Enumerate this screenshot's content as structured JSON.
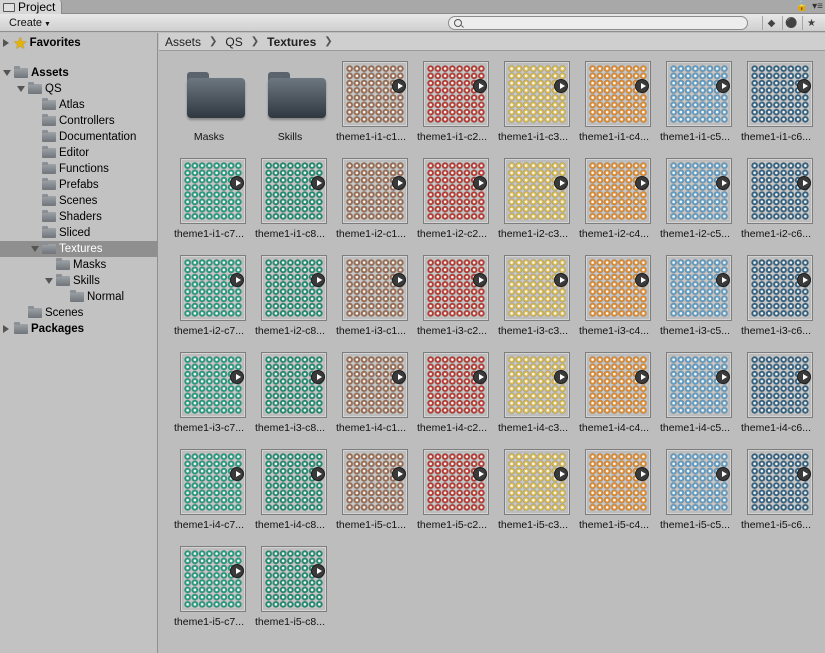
{
  "window": {
    "tab_title": "Project",
    "lock_icon": "lock-icon",
    "menu_icon": "window-menu-icon"
  },
  "toolbar": {
    "create_label": "Create",
    "search_placeholder": "",
    "icons": [
      "filter-by-type-icon",
      "filter-by-label-icon",
      "favorite-star-icon"
    ]
  },
  "sidebar": {
    "items": [
      {
        "label": "Favorites",
        "depth": 0,
        "arrow": "right",
        "icon": "star",
        "bold": true
      },
      {
        "label": "Assets",
        "depth": 0,
        "arrow": "down",
        "icon": "folder",
        "bold": true
      },
      {
        "label": "QS",
        "depth": 1,
        "arrow": "down",
        "icon": "folder"
      },
      {
        "label": "Atlas",
        "depth": 2,
        "arrow": "none",
        "icon": "folder"
      },
      {
        "label": "Controllers",
        "depth": 2,
        "arrow": "none",
        "icon": "folder"
      },
      {
        "label": "Documentation",
        "depth": 2,
        "arrow": "none",
        "icon": "folder"
      },
      {
        "label": "Editor",
        "depth": 2,
        "arrow": "none",
        "icon": "folder"
      },
      {
        "label": "Functions",
        "depth": 2,
        "arrow": "none",
        "icon": "folder"
      },
      {
        "label": "Prefabs",
        "depth": 2,
        "arrow": "none",
        "icon": "folder"
      },
      {
        "label": "Scenes",
        "depth": 2,
        "arrow": "none",
        "icon": "folder"
      },
      {
        "label": "Shaders",
        "depth": 2,
        "arrow": "none",
        "icon": "folder"
      },
      {
        "label": "Sliced",
        "depth": 2,
        "arrow": "none",
        "icon": "folder"
      },
      {
        "label": "Textures",
        "depth": 2,
        "arrow": "down",
        "icon": "folder",
        "selected": true
      },
      {
        "label": "Masks",
        "depth": 3,
        "arrow": "none",
        "icon": "folder"
      },
      {
        "label": "Skills",
        "depth": 3,
        "arrow": "down",
        "icon": "folder"
      },
      {
        "label": "Normal",
        "depth": 4,
        "arrow": "none",
        "icon": "folder"
      },
      {
        "label": "Scenes",
        "depth": 1,
        "arrow": "none",
        "icon": "folder"
      },
      {
        "label": "Packages",
        "depth": 0,
        "arrow": "right",
        "icon": "folder",
        "bold": true
      }
    ]
  },
  "breadcrumb": [
    "Assets",
    "QS",
    "Textures"
  ],
  "colors": {
    "c1": "#9a6a4e",
    "c2": "#b8372e",
    "c3": "#d9b94a",
    "c4": "#e0892a",
    "c5": "#5e9cc4",
    "c6": "#2f5f80",
    "c7": "#1f9a7d",
    "c8": "#1a8a6e"
  },
  "assets": [
    {
      "label": "Masks",
      "kind": "folder"
    },
    {
      "label": "Skills",
      "kind": "folder"
    },
    {
      "label": "theme1-i1-c1...",
      "kind": "texture",
      "color": "c1"
    },
    {
      "label": "theme1-i1-c2...",
      "kind": "texture",
      "color": "c2"
    },
    {
      "label": "theme1-i1-c3...",
      "kind": "texture",
      "color": "c3"
    },
    {
      "label": "theme1-i1-c4...",
      "kind": "texture",
      "color": "c4"
    },
    {
      "label": "theme1-i1-c5...",
      "kind": "texture",
      "color": "c5"
    },
    {
      "label": "theme1-i1-c6...",
      "kind": "texture",
      "color": "c6"
    },
    {
      "label": "theme1-i1-c7...",
      "kind": "texture",
      "color": "c7"
    },
    {
      "label": "theme1-i1-c8...",
      "kind": "texture",
      "color": "c8"
    },
    {
      "label": "theme1-i2-c1...",
      "kind": "texture",
      "color": "c1"
    },
    {
      "label": "theme1-i2-c2...",
      "kind": "texture",
      "color": "c2"
    },
    {
      "label": "theme1-i2-c3...",
      "kind": "texture",
      "color": "c3"
    },
    {
      "label": "theme1-i2-c4...",
      "kind": "texture",
      "color": "c4"
    },
    {
      "label": "theme1-i2-c5...",
      "kind": "texture",
      "color": "c5"
    },
    {
      "label": "theme1-i2-c6...",
      "kind": "texture",
      "color": "c6"
    },
    {
      "label": "theme1-i2-c7...",
      "kind": "texture",
      "color": "c7"
    },
    {
      "label": "theme1-i2-c8...",
      "kind": "texture",
      "color": "c8"
    },
    {
      "label": "theme1-i3-c1...",
      "kind": "texture",
      "color": "c1"
    },
    {
      "label": "theme1-i3-c2...",
      "kind": "texture",
      "color": "c2"
    },
    {
      "label": "theme1-i3-c3...",
      "kind": "texture",
      "color": "c3"
    },
    {
      "label": "theme1-i3-c4...",
      "kind": "texture",
      "color": "c4"
    },
    {
      "label": "theme1-i3-c5...",
      "kind": "texture",
      "color": "c5"
    },
    {
      "label": "theme1-i3-c6...",
      "kind": "texture",
      "color": "c6"
    },
    {
      "label": "theme1-i3-c7...",
      "kind": "texture",
      "color": "c7"
    },
    {
      "label": "theme1-i3-c8...",
      "kind": "texture",
      "color": "c8"
    },
    {
      "label": "theme1-i4-c1...",
      "kind": "texture",
      "color": "c1"
    },
    {
      "label": "theme1-i4-c2...",
      "kind": "texture",
      "color": "c2"
    },
    {
      "label": "theme1-i4-c3...",
      "kind": "texture",
      "color": "c3"
    },
    {
      "label": "theme1-i4-c4...",
      "kind": "texture",
      "color": "c4"
    },
    {
      "label": "theme1-i4-c5...",
      "kind": "texture",
      "color": "c5"
    },
    {
      "label": "theme1-i4-c6...",
      "kind": "texture",
      "color": "c6"
    },
    {
      "label": "theme1-i4-c7...",
      "kind": "texture",
      "color": "c7"
    },
    {
      "label": "theme1-i4-c8...",
      "kind": "texture",
      "color": "c8"
    },
    {
      "label": "theme1-i5-c1...",
      "kind": "texture",
      "color": "c1"
    },
    {
      "label": "theme1-i5-c2...",
      "kind": "texture",
      "color": "c2"
    },
    {
      "label": "theme1-i5-c3...",
      "kind": "texture",
      "color": "c3"
    },
    {
      "label": "theme1-i5-c4...",
      "kind": "texture",
      "color": "c4"
    },
    {
      "label": "theme1-i5-c5...",
      "kind": "texture",
      "color": "c5"
    },
    {
      "label": "theme1-i5-c6...",
      "kind": "texture",
      "color": "c6"
    },
    {
      "label": "theme1-i5-c7...",
      "kind": "texture",
      "color": "c7"
    },
    {
      "label": "theme1-i5-c8...",
      "kind": "texture",
      "color": "c8"
    }
  ]
}
